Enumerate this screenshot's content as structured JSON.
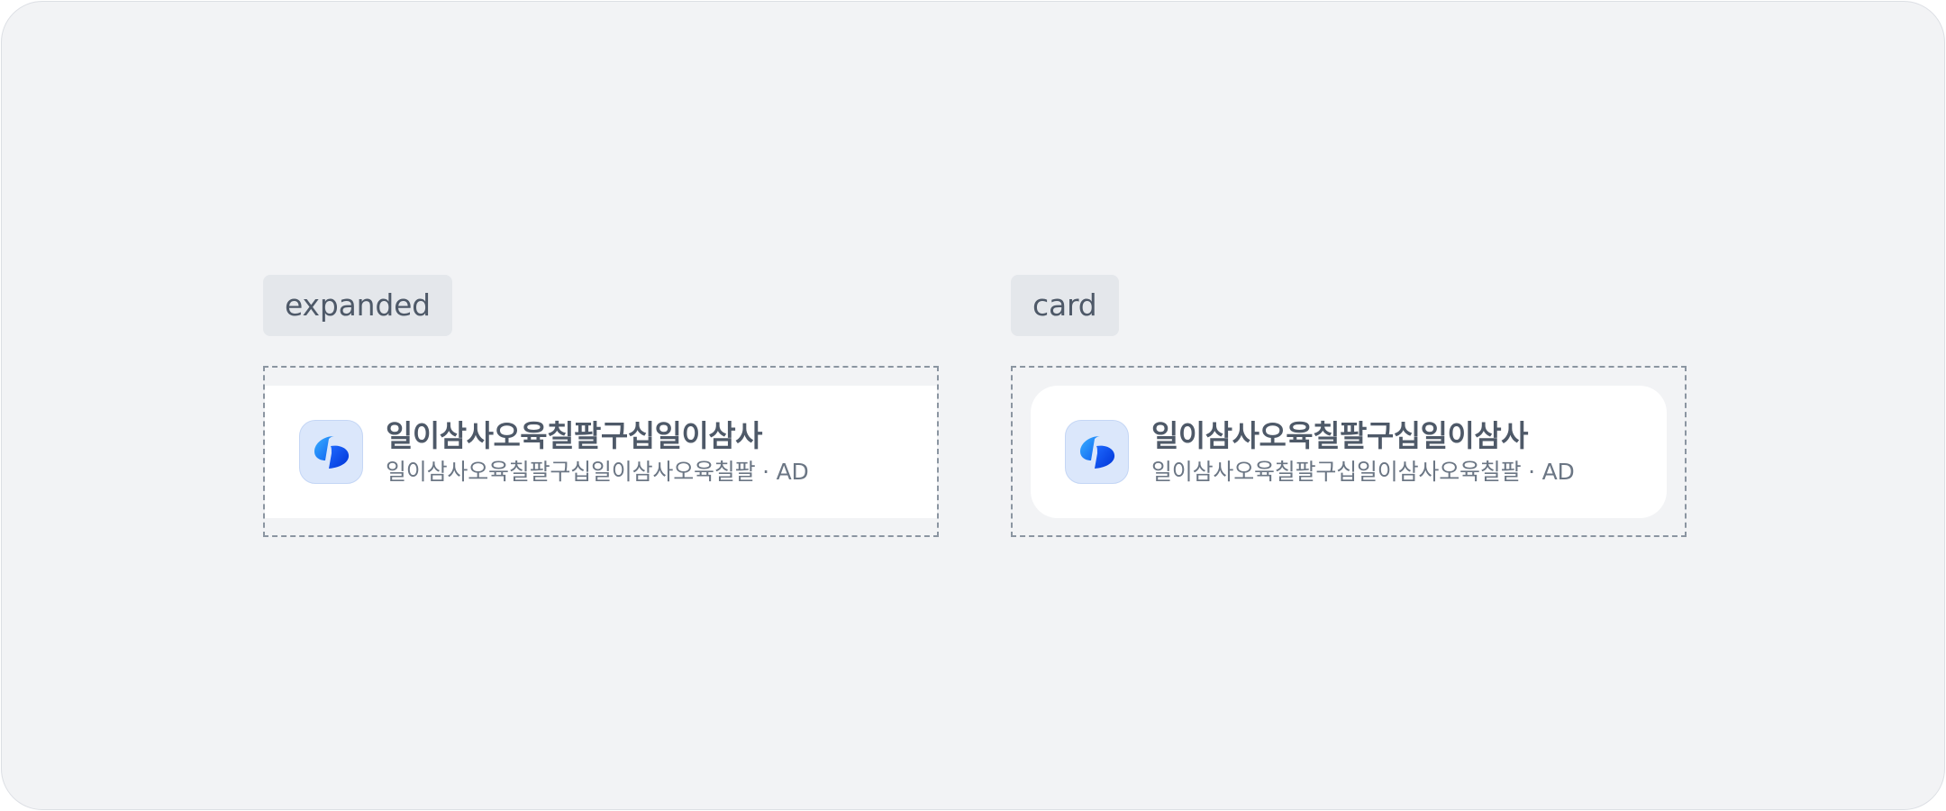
{
  "variants": [
    {
      "tag": "expanded",
      "title": "일이삼사오육칠팔구십일이삼사",
      "subtitle": "일이삼사오육칠팔구십일이삼사오육칠팔 · AD",
      "icon": "toss-logo-icon"
    },
    {
      "tag": "card",
      "title": "일이삼사오육칠팔구십일이삼사",
      "subtitle": "일이삼사오육칠팔구십일이삼사오육칠팔 · AD",
      "icon": "toss-logo-icon"
    }
  ],
  "colors": {
    "background": "#f2f3f5",
    "tag_bg": "#e4e7eb",
    "icon_tile": "#dbe7fb",
    "logo_blue": "#0064ff",
    "title_text": "#4e5968",
    "subtitle_text": "#6b7684"
  }
}
